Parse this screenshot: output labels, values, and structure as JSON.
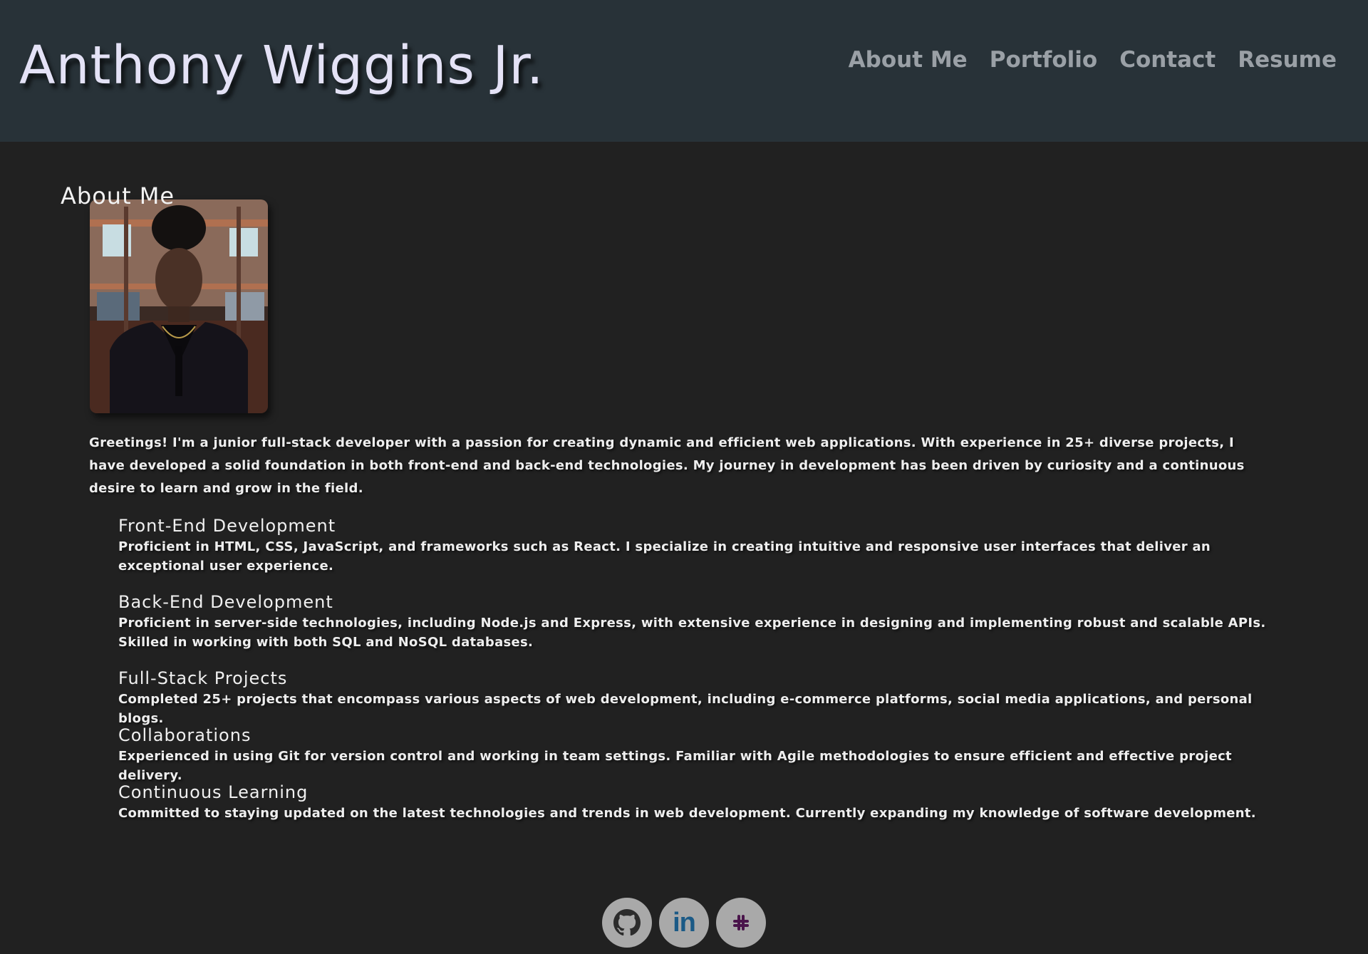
{
  "header": {
    "title": "Anthony Wiggins Jr.",
    "nav": [
      {
        "label": "About Me"
      },
      {
        "label": "Portfolio"
      },
      {
        "label": "Contact"
      },
      {
        "label": "Resume"
      }
    ]
  },
  "about": {
    "heading": "About Me",
    "bio": "Greetings! I'm a junior full-stack developer with a passion for creating dynamic and efficient web applications. With experience in 25+ diverse projects, I have developed a solid foundation in both front-end and back-end technologies. My journey in development has been driven by curiosity and a continuous desire to learn and grow in the field.",
    "skills": [
      {
        "title": "Front-End Development",
        "desc": "Proficient in HTML, CSS, JavaScript, and frameworks such as React. I specialize in creating intuitive and responsive user interfaces that deliver an exceptional user experience."
      },
      {
        "title": "Back-End Development",
        "desc": "Proficient in server-side technologies, including Node.js and Express, with extensive experience in designing and implementing robust and scalable APIs. Skilled in working with both SQL and NoSQL databases."
      },
      {
        "title": "Full-Stack Projects",
        "desc": "Completed 25+ projects that encompass various aspects of web development, including e-commerce platforms, social media applications, and personal blogs."
      },
      {
        "title": "Collaborations",
        "desc": "Experienced in using Git for version control and working in team settings. Familiar with Agile methodologies to ensure efficient and effective project delivery."
      },
      {
        "title": "Continuous Learning",
        "desc": "Committed to staying updated on the latest technologies and trends in web development. Currently expanding my knowledge of software development."
      }
    ]
  },
  "footer": {
    "social": [
      {
        "icon": "github-icon"
      },
      {
        "icon": "linkedin-icon",
        "text": "in"
      },
      {
        "icon": "slack-icon"
      }
    ]
  },
  "colors": {
    "header_bg": "#283238",
    "page_bg": "#212121",
    "title": "#e4e2f6",
    "nav": "#9aa0a6",
    "social_bg": "#a9a9a9",
    "linkedin": "#1b5a86",
    "slack": "#4a154b"
  }
}
